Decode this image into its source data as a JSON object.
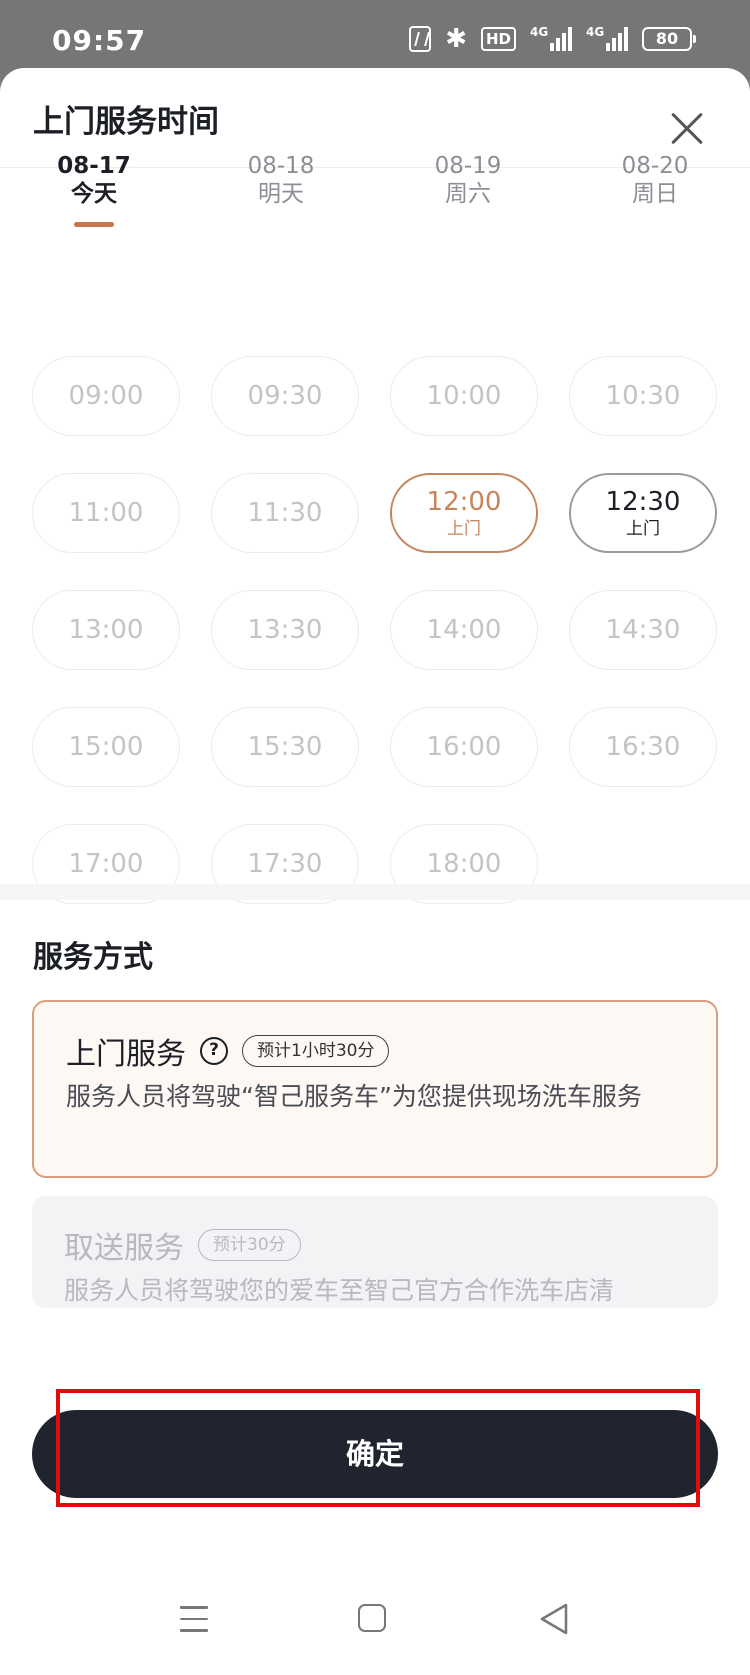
{
  "status_bar": {
    "time": "09:57",
    "hd_label": "HD",
    "net1": "4G",
    "net2": "4G",
    "battery": "80"
  },
  "sheet": {
    "title": "上门服务时间"
  },
  "dates": [
    {
      "date": "08-17",
      "label": "今天",
      "active": true
    },
    {
      "date": "08-18",
      "label": "明天",
      "active": false
    },
    {
      "date": "08-19",
      "label": "周六",
      "active": false
    },
    {
      "date": "08-20",
      "label": "周日",
      "active": false
    }
  ],
  "time_slots": [
    {
      "time": "09:00",
      "state": "disabled"
    },
    {
      "time": "09:30",
      "state": "disabled"
    },
    {
      "time": "10:00",
      "state": "disabled"
    },
    {
      "time": "10:30",
      "state": "disabled"
    },
    {
      "time": "11:00",
      "state": "disabled"
    },
    {
      "time": "11:30",
      "state": "disabled"
    },
    {
      "time": "12:00",
      "state": "selected",
      "sub": "上门"
    },
    {
      "time": "12:30",
      "state": "available",
      "sub": "上门"
    },
    {
      "time": "13:00",
      "state": "disabled"
    },
    {
      "time": "13:30",
      "state": "disabled"
    },
    {
      "time": "14:00",
      "state": "disabled"
    },
    {
      "time": "14:30",
      "state": "disabled"
    },
    {
      "time": "15:00",
      "state": "disabled"
    },
    {
      "time": "15:30",
      "state": "disabled"
    },
    {
      "time": "16:00",
      "state": "disabled"
    },
    {
      "time": "16:30",
      "state": "disabled"
    },
    {
      "time": "17:00",
      "state": "disabled"
    },
    {
      "time": "17:30",
      "state": "disabled"
    },
    {
      "time": "18:00",
      "state": "disabled"
    }
  ],
  "service": {
    "section_title": "服务方式",
    "options": [
      {
        "name": "上门服务",
        "estimate": "预计1小时30分",
        "desc": "服务人员将驾驶“智己服务车”为您提供现场洗车服务",
        "help_icon": "question-icon"
      },
      {
        "name": "取送服务",
        "estimate": "预计30分",
        "desc": "服务人员将驾驶您的爱车至智己官方合作洗车店清"
      }
    ]
  },
  "confirm_label": "确定",
  "colors": {
    "accent": "#c8845c",
    "primary_button": "#20242f",
    "highlight": "#e00b0b"
  }
}
